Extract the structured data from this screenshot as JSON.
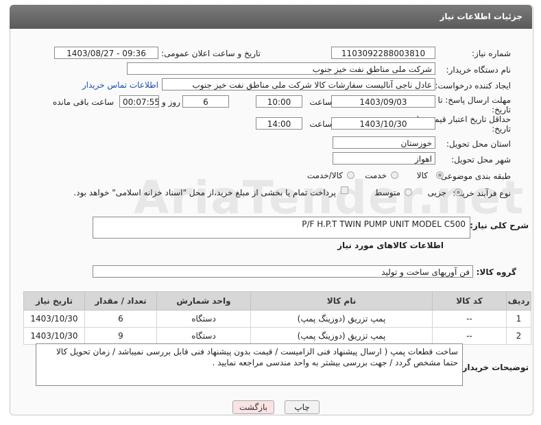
{
  "header": {
    "title": "جزئیات اطلاعات نیاز"
  },
  "watermark": "AriaTender.net",
  "need_number": {
    "label": "شماره نیاز:",
    "value": "1103092288003810"
  },
  "announce_datetime": {
    "label": "تاریخ و ساعت اعلان عمومی:",
    "value": "1403/08/27 - 09:36"
  },
  "buyer_org": {
    "label": "نام دستگاه خریدار:",
    "value": "شرکت ملی مناطق نفت خیز جنوب"
  },
  "requester": {
    "label": "ایجاد کننده درخواست:",
    "value": "عادل  ناجی آنالیست سفارشات کالا  شرکت ملی مناطق نفت خیز جنوب",
    "contact_link": "اطلاعات تماس خریدار"
  },
  "reply_deadline": {
    "label_line1": "مهلت ارسال پاسخ: تا",
    "label_line2": "تاریخ:",
    "date": "1403/09/03",
    "time_label": "ساعت",
    "time": "10:00",
    "days": "6",
    "days_label": "روز و",
    "remaining": "00:07:55",
    "remaining_label": "ساعت باقی مانده"
  },
  "price_validity": {
    "label_line1": "حداقل تاریخ اعتبار قیمت: تا",
    "label_line2": "تاریخ:",
    "date": "1403/10/30",
    "time_label": "ساعت",
    "time": "14:00"
  },
  "province": {
    "label": "استان محل تحویل:",
    "value": "خوزستان"
  },
  "city": {
    "label": "شهر محل تحویل:",
    "value": "اهواز"
  },
  "category": {
    "label": "طبقه بندی موضوعی:",
    "options": [
      "کالا",
      "خدمت",
      "کالا/خدمت"
    ]
  },
  "purchase_process": {
    "label": "نوع فرآیند خرید :",
    "options": [
      "جزیی",
      "متوسط"
    ],
    "payment_note": "پرداخت تمام یا بخشی از مبلغ خرید،از محل \"اسناد خزانه اسلامی\" خواهد بود."
  },
  "general_desc": {
    "label": "شرح کلی نیاز:",
    "value": "P/F H.P.T  TWIN PUMP UNIT MODEL C500"
  },
  "goods_info_title": "اطلاعات کالاهای مورد نیاز",
  "goods_group": {
    "label": "گروه کالا:",
    "value": "فن آوریهای ساخت و تولید"
  },
  "table": {
    "headers": [
      "ردیف",
      "کد کالا",
      "نام کالا",
      "واحد شمارش",
      "تعداد / مقدار",
      "تاریخ نیاز"
    ],
    "rows": [
      [
        "1",
        "--",
        "پمپ تزریق (دوزینگ پمپ)",
        "دستگاه",
        "6",
        "1403/10/30"
      ],
      [
        "2",
        "--",
        "پمپ تزریق (دوزینگ پمپ)",
        "دستگاه",
        "9",
        "1403/10/30"
      ]
    ]
  },
  "buyer_notes": {
    "label": "توضیحات خریدار:",
    "value": "ساخت قطعات پمپ ( ارسال پیشنهاد فنی الزامیست / قیمت بدون پیشنهاد فنی قابل بررسی نمیباشد / زمان تحویل کالا حتما مشخص گردد / جهت بررسی بیشتر به واحد مندسی مراجعه نمایید ."
  },
  "buttons": {
    "print": "چاپ",
    "back": "بازگشت"
  }
}
